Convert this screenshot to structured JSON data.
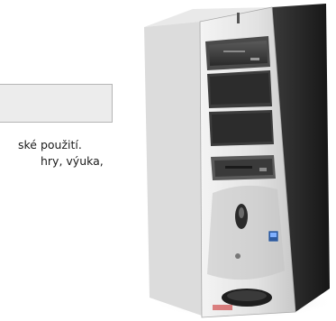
{
  "text_lines": [
    "ské použití.",
    "hry, výuka,"
  ],
  "brand_label": "",
  "colors": {
    "box_fill": "#ececec",
    "box_border": "#b5b5b5",
    "text": "#1a1a1a"
  },
  "icons": {
    "computer": "pc-tower-illustration"
  }
}
